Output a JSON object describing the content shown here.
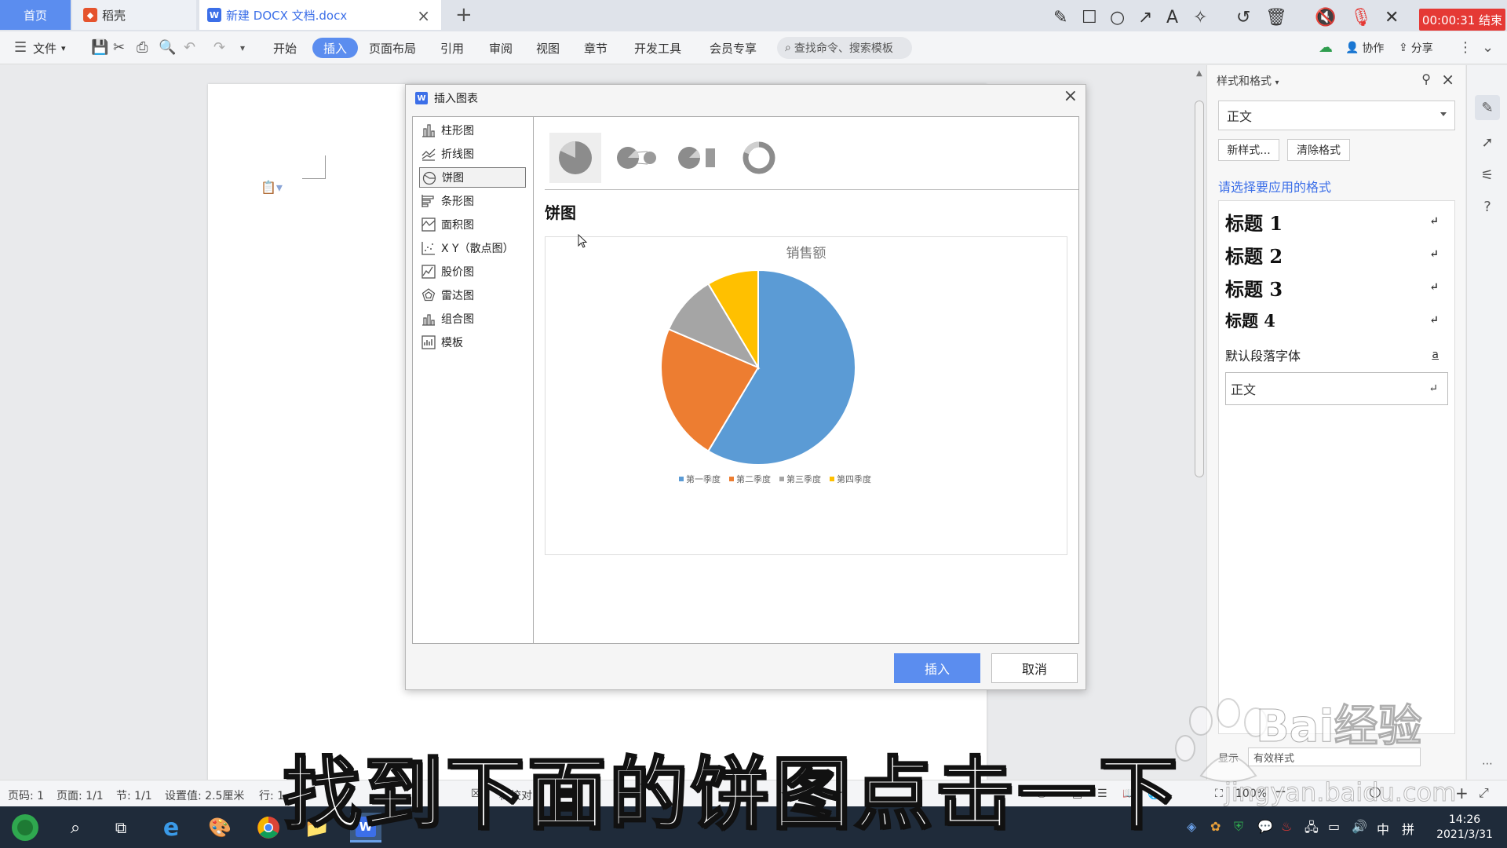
{
  "tabs": {
    "home": "首页",
    "daoke": "稻壳",
    "doc": "新建 DOCX 文档.docx"
  },
  "timer": "00:00:31 结束",
  "ribbon": {
    "file": "文件",
    "menus": [
      "开始",
      "插入",
      "页面布局",
      "引用",
      "审阅",
      "视图",
      "章节",
      "开发工具",
      "会员专享"
    ],
    "search_placeholder": "查找命令、搜索模板",
    "collab": "协作",
    "share": "分享"
  },
  "dialog": {
    "title": "插入图表",
    "types": [
      "柱形图",
      "折线图",
      "饼图",
      "条形图",
      "面积图",
      "X Y（散点图）",
      "股价图",
      "雷达图",
      "组合图",
      "模板"
    ],
    "selected_type": "饼图",
    "heading": "饼图",
    "insert": "插入",
    "cancel": "取消"
  },
  "chart_data": {
    "type": "pie",
    "title": "销售额",
    "categories": [
      "第一季度",
      "第二季度",
      "第三季度",
      "第四季度"
    ],
    "values": [
      8.2,
      3.2,
      1.4,
      1.2
    ],
    "colors": [
      "#5b9bd5",
      "#ed7d31",
      "#a5a5a5",
      "#ffc000"
    ],
    "legend": "bottom"
  },
  "right_panel": {
    "title": "样式和格式",
    "current_style": "正文",
    "new_style": "新样式...",
    "clear_format": "清除格式",
    "hint": "请选择要应用的格式",
    "styles": [
      {
        "label": "标题  1",
        "mark": "↵"
      },
      {
        "label": "标题  2",
        "mark": "↵"
      },
      {
        "label": "标题  3",
        "mark": "↵"
      },
      {
        "label": "标题  4",
        "mark": "↵"
      }
    ],
    "default_font": "默认段落字体",
    "default_font_mark": "a",
    "body_style": "正文",
    "body_mark": "↵",
    "display_label": "显示",
    "display_value": "有效样式"
  },
  "statusbar": {
    "page_no": "页码: 1",
    "pages": "页面: 1/1",
    "section": "节: 1/1",
    "setting": "设置值: 2.5厘米",
    "row": "行: 1",
    "proofread": "档校对",
    "zoom": "100%"
  },
  "taskbar": {
    "time": "14:26",
    "date": "2021/3/31",
    "ime_lang": "中",
    "ime_mode": "拼"
  },
  "caption": "找到下面的饼图点击一下",
  "watermark": {
    "brand": "Bai经验",
    "url": "jingyan.baidu.com"
  }
}
